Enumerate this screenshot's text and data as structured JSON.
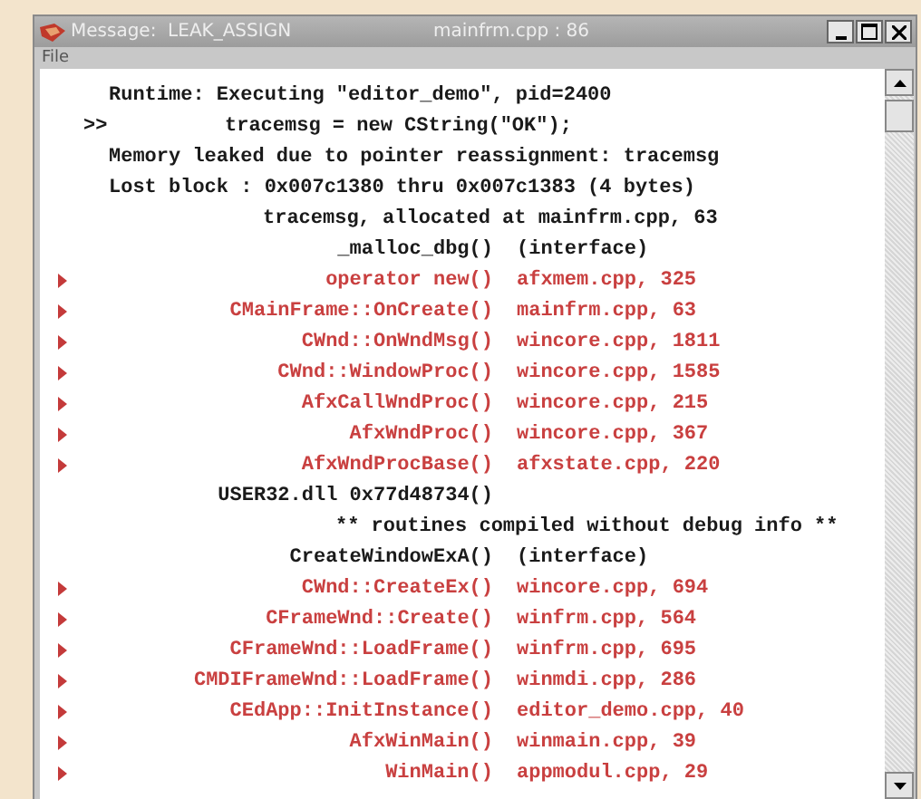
{
  "window": {
    "title": "Message:  LEAK_ASSIGN",
    "file_ref": "mainfrm.cpp : 86"
  },
  "menu": [
    "File"
  ],
  "lines": [
    {
      "kind": "status",
      "text": "Runtime: Executing \"editor_demo\", pid=2400"
    },
    {
      "kind": "marker",
      "marker": ">>",
      "text": "tracemsg = new CString(\"OK\");"
    },
    {
      "kind": "status",
      "text": "Memory leaked due to pointer reassignment: tracemsg"
    },
    {
      "kind": "status",
      "text": "Lost block : 0x007c1380 thru 0x007c1383 (4 bytes)"
    },
    {
      "kind": "detail",
      "text": "tracemsg, allocated at mainfrm.cpp, 63"
    },
    {
      "kind": "frame",
      "function": "_malloc_dbg()",
      "location": "(interface)",
      "flagged": false
    },
    {
      "kind": "frame",
      "function": "operator new()",
      "location": "afxmem.cpp, 325",
      "flagged": true
    },
    {
      "kind": "frame",
      "function": "CMainFrame::OnCreate()",
      "location": "mainfrm.cpp, 63",
      "flagged": true
    },
    {
      "kind": "frame",
      "function": "CWnd::OnWndMsg()",
      "location": "wincore.cpp, 1811",
      "flagged": true
    },
    {
      "kind": "frame",
      "function": "CWnd::WindowProc()",
      "location": "wincore.cpp, 1585",
      "flagged": true
    },
    {
      "kind": "frame",
      "function": "AfxCallWndProc()",
      "location": "wincore.cpp, 215",
      "flagged": true
    },
    {
      "kind": "frame",
      "function": "AfxWndProc()",
      "location": "wincore.cpp, 367",
      "flagged": true
    },
    {
      "kind": "frame",
      "function": "AfxWndProcBase()",
      "location": "afxstate.cpp, 220",
      "flagged": true
    },
    {
      "kind": "frame",
      "function": "USER32.dll 0x77d48734()",
      "flagged": false
    },
    {
      "kind": "note",
      "text": "** routines compiled without debug info **"
    },
    {
      "kind": "frame",
      "function": "CreateWindowExA()",
      "location": "(interface)",
      "flagged": false
    },
    {
      "kind": "frame",
      "function": "CWnd::CreateEx()",
      "location": "wincore.cpp, 694",
      "flagged": true
    },
    {
      "kind": "frame",
      "function": "CFrameWnd::Create()",
      "location": "winfrm.cpp, 564",
      "flagged": true
    },
    {
      "kind": "frame",
      "function": "CFrameWnd::LoadFrame()",
      "location": "winfrm.cpp, 695",
      "flagged": true
    },
    {
      "kind": "frame",
      "function": "CMDIFrameWnd::LoadFrame()",
      "location": "winmdi.cpp, 286",
      "flagged": true
    },
    {
      "kind": "frame",
      "function": "CEdApp::InitInstance()",
      "location": "editor_demo.cpp, 40",
      "flagged": true
    },
    {
      "kind": "frame",
      "function": "AfxWinMain()",
      "location": "winmain.cpp, 39",
      "flagged": true
    },
    {
      "kind": "frame",
      "function": "WinMain()",
      "location": "appmodul.cpp, 29",
      "flagged": true
    }
  ]
}
